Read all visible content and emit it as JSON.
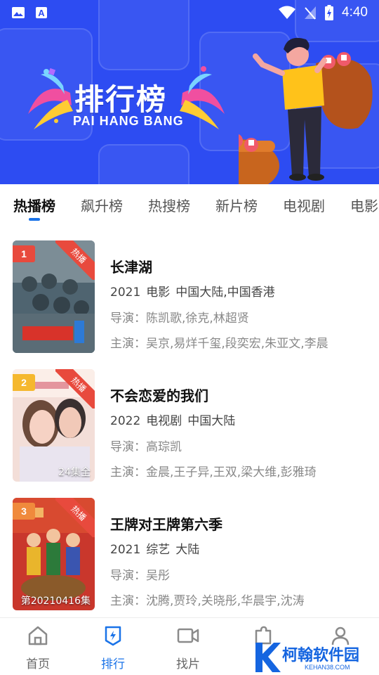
{
  "status_bar": {
    "time": "4:40"
  },
  "banner": {
    "title": "排行榜",
    "subtitle": "PAI HANG BANG"
  },
  "tabs": [
    {
      "label": "热播榜",
      "active": true
    },
    {
      "label": "飙升榜"
    },
    {
      "label": "热搜榜"
    },
    {
      "label": "新片榜"
    },
    {
      "label": "电视剧"
    },
    {
      "label": "电影"
    }
  ],
  "list": [
    {
      "rank": "1",
      "badge": "热播",
      "caption": "",
      "title": "长津湖",
      "year": "2021",
      "category": "电影",
      "region": "中国大陆,中国香港",
      "director": "导演：陈凯歌,徐克,林超贤",
      "cast": "主演：吴京,易烊千玺,段奕宏,朱亚文,李晨",
      "rank_color": "#e84a3d"
    },
    {
      "rank": "2",
      "badge": "热播",
      "caption": "24集全",
      "title": "不会恋爱的我们",
      "year": "2022",
      "category": "电视剧",
      "region": "中国大陆",
      "director": "导演：高琮凯",
      "cast": "主演：金晨,王子异,王双,梁大维,彭雅琦",
      "rank_color": "#f5b82e"
    },
    {
      "rank": "3",
      "badge": "热播",
      "caption": "第20210416集",
      "title": "王牌对王牌第六季",
      "year": "2021",
      "category": "综艺",
      "region": "大陆",
      "director": "导演：吴彤",
      "cast": "主演：沈腾,贾玲,关晓彤,华晨宇,沈涛",
      "rank_color": "#f08a3c"
    }
  ],
  "bottom_nav": [
    {
      "label": "首页",
      "icon": "home-icon"
    },
    {
      "label": "排行",
      "icon": "ranking-icon",
      "active": true
    },
    {
      "label": "找片",
      "icon": "video-icon"
    },
    {
      "label": "",
      "icon": "puzzle-icon"
    },
    {
      "label": "",
      "icon": "user-icon"
    }
  ],
  "watermark": {
    "text": "柯翰软件园",
    "sub": "KEHAN38.COM"
  },
  "colors": {
    "banner_blue": "#2d4cf2",
    "accent": "#1a73e8",
    "hot_red": "#e84a3d"
  }
}
